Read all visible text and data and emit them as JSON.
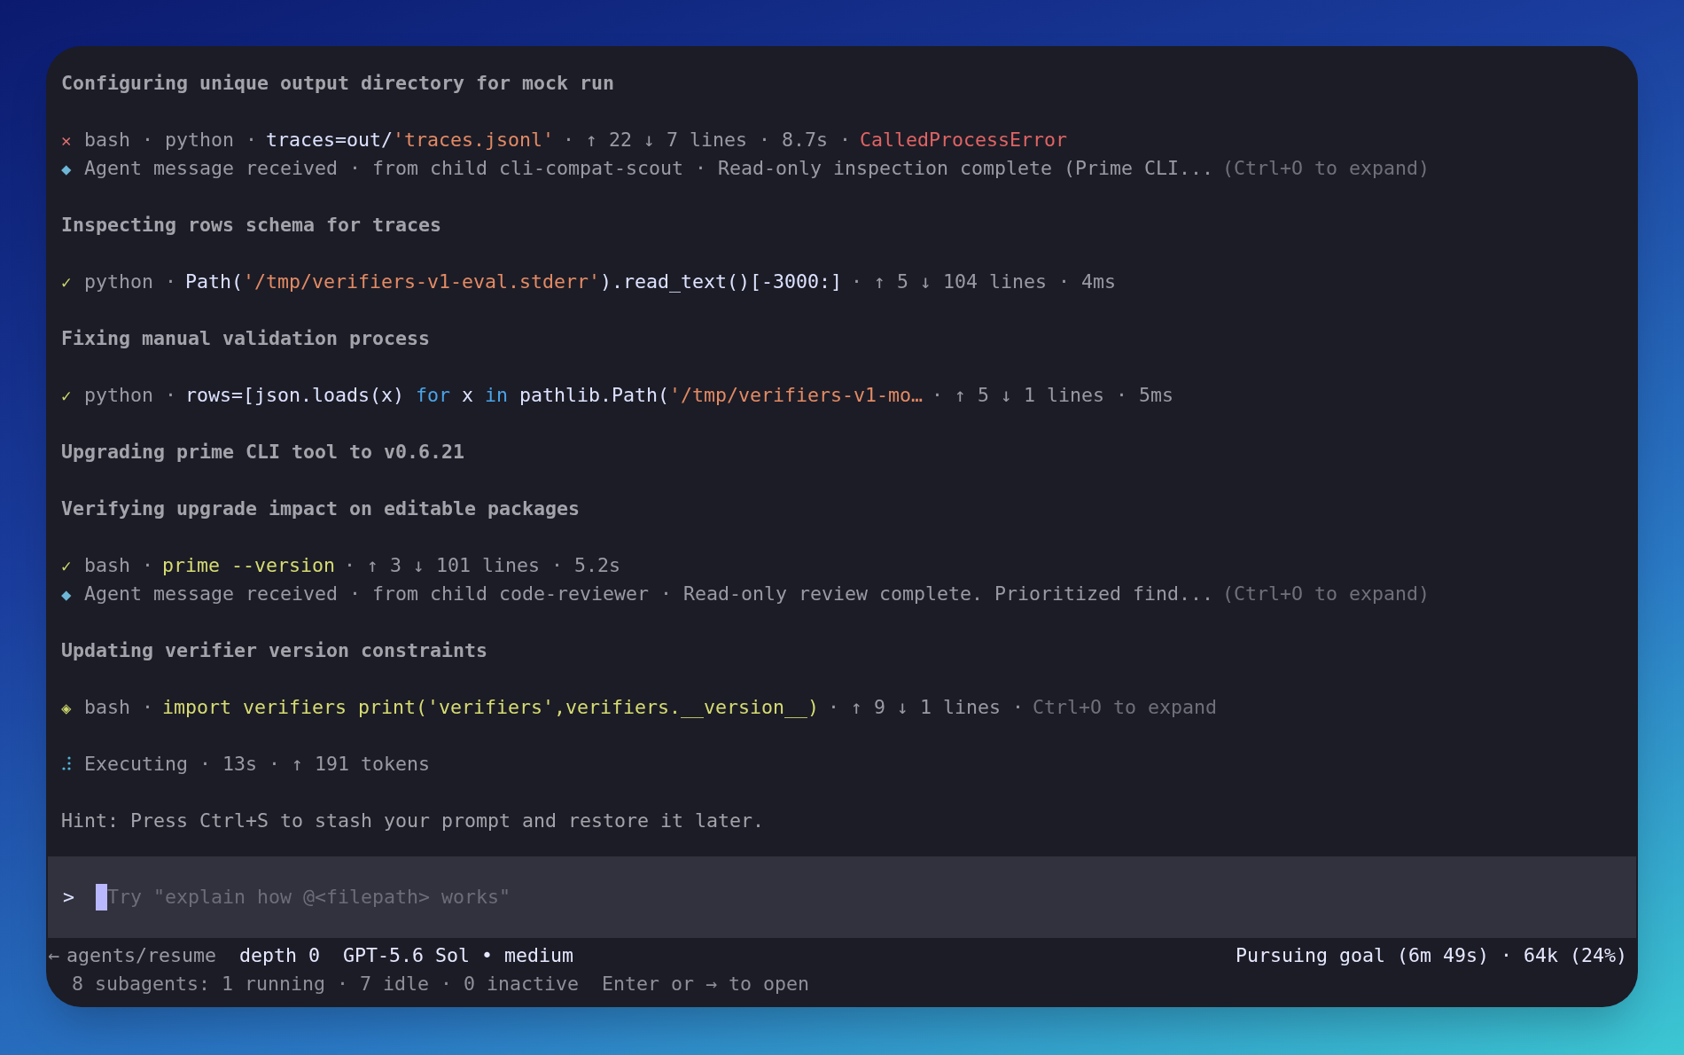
{
  "blocks": [
    {
      "lines": [
        {
          "kind": "heading",
          "text": "Configuring unique output directory for mock run"
        }
      ]
    },
    {
      "lines": [
        {
          "kind": "failed",
          "icon": "✕",
          "segments": [
            {
              "kind": "meta",
              "text": "bash · python ·"
            },
            {
              "kind": "command",
              "tokens": [
                {
                  "kind": "code",
                  "text": "traces=out/"
                },
                {
                  "kind": "string",
                  "text": "'traces.jsonl'"
                }
              ]
            },
            {
              "kind": "meta",
              "text": "· ↑ 22 ↓ 7 lines · 8.7s ·"
            },
            {
              "kind": "error",
              "text": "CalledProcessError"
            }
          ]
        },
        {
          "kind": "agent",
          "icon": "◆",
          "segments": [
            {
              "kind": "meta",
              "text": "Agent message received · from child cli-compat-scout · Read-only inspection complete (Prime CLI..."
            },
            {
              "kind": "hint",
              "text": "(Ctrl+O to expand)"
            }
          ]
        }
      ]
    },
    {
      "lines": [
        {
          "kind": "heading",
          "text": "Inspecting rows schema for traces"
        }
      ]
    },
    {
      "lines": [
        {
          "kind": "done",
          "icon": "✓",
          "segments": [
            {
              "kind": "meta",
              "text": "python ·"
            },
            {
              "kind": "command",
              "tokens": [
                {
                  "kind": "code",
                  "text": "Path("
                },
                {
                  "kind": "string",
                  "text": "'/tmp/verifiers-v1-eval.stderr'"
                },
                {
                  "kind": "code",
                  "text": ").read_text()[-3000:]"
                }
              ]
            },
            {
              "kind": "meta",
              "text": "· ↑ 5 ↓ 104 lines · 4ms"
            }
          ]
        }
      ]
    },
    {
      "lines": [
        {
          "kind": "heading",
          "text": "Fixing manual validation process"
        }
      ]
    },
    {
      "lines": [
        {
          "kind": "done",
          "icon": "✓",
          "segments": [
            {
              "kind": "meta",
              "text": "python ·"
            },
            {
              "kind": "command",
              "tokens": [
                {
                  "kind": "code",
                  "text": "rows=[json.loads(x) "
                },
                {
                  "kind": "keyword",
                  "text": "for"
                },
                {
                  "kind": "code",
                  "text": " x "
                },
                {
                  "kind": "keyword",
                  "text": "in"
                },
                {
                  "kind": "code",
                  "text": " pathlib.Path("
                },
                {
                  "kind": "string",
                  "text": "'/tmp/verifiers-v1-mo…"
                }
              ]
            },
            {
              "kind": "meta",
              "text": "· ↑ 5 ↓ 1 lines · 5ms"
            }
          ]
        }
      ]
    },
    {
      "lines": [
        {
          "kind": "heading",
          "text": "Upgrading prime CLI tool to v0.6.21"
        }
      ]
    },
    {
      "lines": [
        {
          "kind": "heading",
          "text": "Verifying upgrade impact on editable packages"
        }
      ]
    },
    {
      "lines": [
        {
          "kind": "done",
          "icon": "✓",
          "segments": [
            {
              "kind": "meta",
              "text": "bash ·"
            },
            {
              "kind": "command",
              "tokens": [
                {
                  "kind": "shell",
                  "text": "prime --version"
                }
              ]
            },
            {
              "kind": "meta",
              "text": "· ↑ 3 ↓ 101 lines · 5.2s"
            }
          ]
        },
        {
          "kind": "agent",
          "icon": "◆",
          "segments": [
            {
              "kind": "meta",
              "text": "Agent message received · from child code-reviewer · Read-only review complete. Prioritized find..."
            },
            {
              "kind": "hint",
              "text": "(Ctrl+O to expand)"
            }
          ]
        }
      ]
    },
    {
      "lines": [
        {
          "kind": "heading",
          "text": "Updating verifier version constraints"
        }
      ]
    },
    {
      "lines": [
        {
          "kind": "running",
          "icon": "◈",
          "segments": [
            {
              "kind": "meta",
              "text": "bash ·"
            },
            {
              "kind": "command",
              "tokens": [
                {
                  "kind": "shell",
                  "text": "import verifiers print('verifiers',verifiers.__version__)"
                }
              ]
            },
            {
              "kind": "meta",
              "text": "· ↑ 9 ↓ 1 lines ·"
            },
            {
              "kind": "hint",
              "text": "Ctrl+O to expand"
            }
          ]
        }
      ]
    },
    {
      "lines": [
        {
          "kind": "executing",
          "segments": [
            {
              "kind": "meta",
              "text": "Executing · 13s · ↑ 191 tokens"
            }
          ]
        }
      ]
    },
    {
      "lines": [
        {
          "kind": "hint",
          "text": "Hint: Press Ctrl+S to stash your prompt and restore it later."
        }
      ]
    }
  ],
  "prompt": {
    "symbol": ">",
    "placeholder": "Try \"explain how @<filepath> works\""
  },
  "status_bar": {
    "back_arrow": "←",
    "path": "agents/resume",
    "depth": "depth 0",
    "model": "GPT-5.6 Sol • medium",
    "goal": "Pursuing goal (6m 49s) · 64k (24%)",
    "subagents": "8 subagents: 1 running · 7 idle · 0 inactive",
    "open_hint": "Enter or → to open"
  }
}
